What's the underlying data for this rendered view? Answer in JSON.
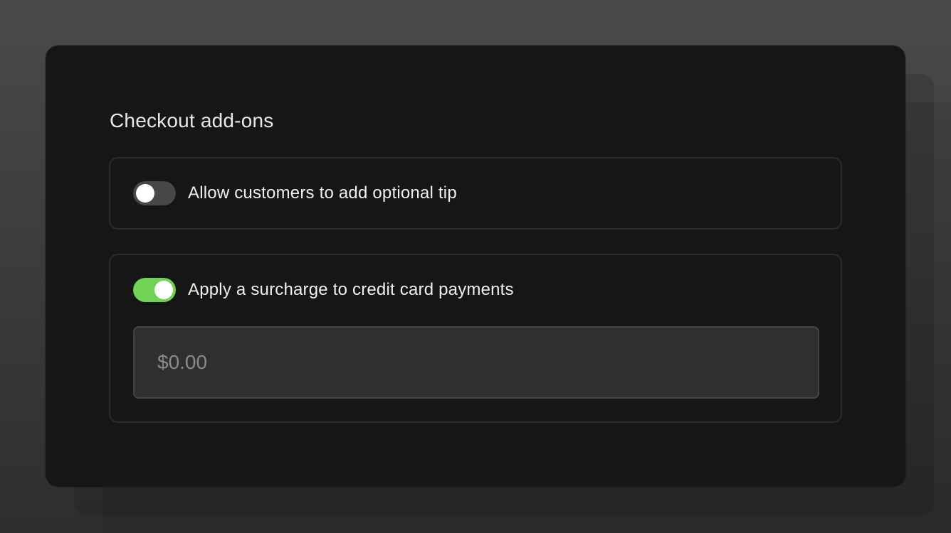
{
  "checkout": {
    "title": "Checkout add-ons",
    "tip_option": {
      "label": "Allow customers to add optional tip",
      "enabled": false
    },
    "surcharge_option": {
      "label": "Apply a surcharge to credit card payments",
      "enabled": true,
      "amount_value": "",
      "amount_placeholder": "$0.00"
    }
  },
  "colors": {
    "toggle_on": "#6fd356",
    "toggle_off": "#474747",
    "card_background": "#161616"
  }
}
